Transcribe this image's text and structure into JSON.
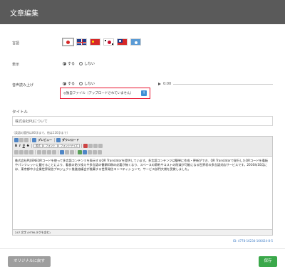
{
  "header": {
    "title": "文章編集"
  },
  "language": {
    "label": "言語",
    "flags": [
      {
        "icon": "japan-flag-icon",
        "bg": "#ffffff",
        "mark": "#d62828"
      },
      {
        "icon": "uk-flag-icon",
        "bg": "#1f3c8c",
        "mark": "#d62828"
      },
      {
        "icon": "china-flag-icon",
        "bg": "#d62828",
        "mark": "#ffde00"
      },
      {
        "icon": "korea-flag-icon",
        "bg": "#ffffff",
        "mark": "#c8102e"
      },
      {
        "icon": "taiwan-flag-icon",
        "bg": "#d62828",
        "mark": "#1f3c8c"
      },
      {
        "icon": "hongkong-language-flag-icon",
        "bg": "#5b9bd5",
        "mark": "#ffffff"
      }
    ]
  },
  "display": {
    "label": "表示",
    "option_on": "する",
    "option_off": "しない",
    "selected": "on"
  },
  "tts": {
    "label": "音声読み上げ",
    "option_on": "する",
    "option_off": "しない",
    "selected": "on",
    "file_label": "◎独自ファイル（アップロードされていません）",
    "upload_icon": "upload-icon",
    "audio_time": "0:00"
  },
  "title_field": {
    "label": "タイトル",
    "value": "株式会社PIJについて"
  },
  "body_hint": "（英語の箇所は80字まで、他は120字まで）",
  "editor": {
    "toolbar": {
      "preview_label": "プレビュー",
      "download_label": "ダウンロード",
      "style_select": "書式",
      "font_select": "フォント",
      "size_select": "フォントサイズ"
    },
    "text": "株式会社PIJ(ENEQRコードを使って多言語コンテンツを表示するQR Translatorを提供しています。多言語コンテンツは簡単に作成・更新ができ、QR Translatorで発行したQRコードを看板やパンフレットに載せることにより、看板の貼り換えや多言語の書類印刷の必要が無くなり、スペースの節約やコストの削減が可能になる世界初の多言語対応サービスです。2016年10月には、東京都中小企業世界発信プロジェクト推進協議会が推薦する世界発信コンペティションで、サービス部門大賞を受賞しました。",
    "status": "247 文字 (HTMLタグを含む)"
  },
  "doc_id": "ID: 4778-16234-166424-8-5",
  "footer": {
    "revert_label": "オリジナルに戻す",
    "save_label": "保存"
  },
  "colors": {
    "header_bg": "#5a5a5a",
    "save_green": "#3aa84a",
    "highlight_red": "#e8112d"
  }
}
